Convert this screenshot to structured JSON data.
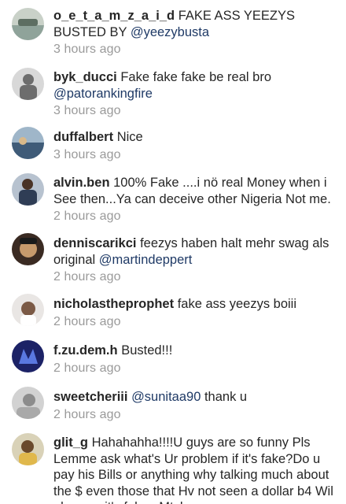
{
  "comments": [
    {
      "username": "o_e_t_a_m_z_a_i_d",
      "text": "FAKE ASS YEEZYS BUSTED BY",
      "mention": "@yeezybusta",
      "time": "3 hours ago",
      "avatar_colors": [
        "#8fa39a",
        "#c9d1c8"
      ]
    },
    {
      "username": "byk_ducci",
      "text": "Fake fake fake be real bro",
      "mention": "@patorankingfire",
      "time": "3 hours ago",
      "avatar_colors": [
        "#6d6d6d",
        "#d8d8d8"
      ]
    },
    {
      "username": "duffalbert",
      "text": "Nice",
      "time": "3 hours ago",
      "avatar_colors": [
        "#3f5b78",
        "#9fb6c9"
      ]
    },
    {
      "username": "alvin.ben",
      "text": "100% Fake ....i nö real Money when i See then...Ya can deceive other Nigeria Not me.",
      "time": "2 hours ago",
      "avatar_colors": [
        "#2f3d55",
        "#b7c2cf"
      ]
    },
    {
      "username": "denniscarikci",
      "text": "feezys haben halt mehr swag als original",
      "mention": "@martindeppert",
      "time": "2 hours ago",
      "avatar_colors": [
        "#3a2a22",
        "#c79a6c"
      ]
    },
    {
      "username": "nicholastheprophet",
      "text": "fake ass yeezys boiii",
      "time": "2 hours ago",
      "avatar_colors": [
        "#e9e6e4",
        "#7b5a46"
      ]
    },
    {
      "username": "f.zu.dem.h",
      "text": "Busted!!!",
      "time": "2 hours ago",
      "avatar_colors": [
        "#1c2266",
        "#5a78e0"
      ]
    },
    {
      "username": "sweetcheriii",
      "mention": "@sunitaa90",
      "text_after": "thank u",
      "time": "2 hours ago",
      "avatar_colors": [
        "#8c8c8c",
        "#d2d2d2"
      ]
    },
    {
      "username": "glit_g",
      "text": "Hahahahha!!!!U guys are so funny Pls Lemme ask what's Ur problem if it's fake?Do u pay his Bills or anything why talking much about the $ even those that Hv not seen a dollar b4 Wil also say it's fake...Mtcheew",
      "avatar_colors": [
        "#d9d2b8",
        "#6a4a2c"
      ]
    }
  ]
}
